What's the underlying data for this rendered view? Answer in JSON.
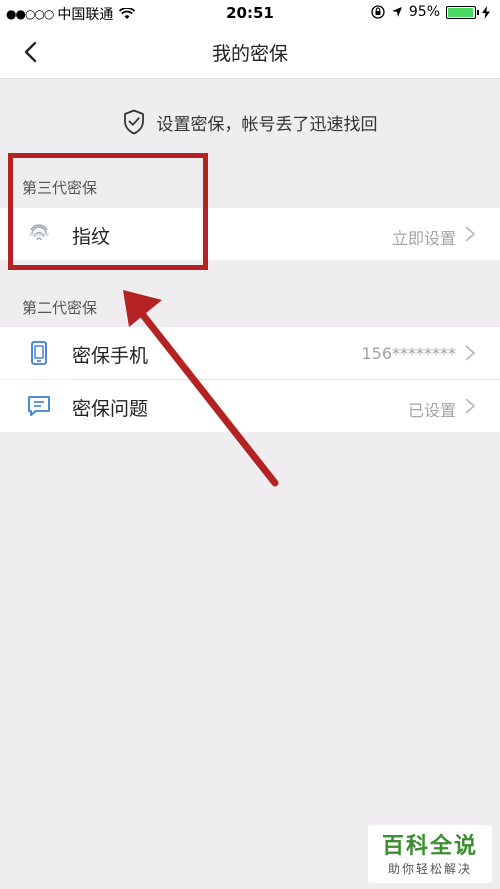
{
  "status_bar": {
    "signal": "●●○○○",
    "carrier": "中国联通",
    "time": "20:51",
    "battery_text": "95%",
    "battery_level": 0.95
  },
  "nav": {
    "title": "我的密保"
  },
  "notice": {
    "text": "设置密保，帐号丢了迅速找回"
  },
  "sections": {
    "third_gen": {
      "header": "第三代密保",
      "fingerprint": {
        "label": "指纹",
        "value": "立即设置"
      }
    },
    "second_gen": {
      "header": "第二代密保",
      "phone": {
        "label": "密保手机",
        "value": "156********"
      },
      "question": {
        "label": "密保问题",
        "value": "已设置"
      }
    }
  },
  "watermark": {
    "title": "百科全说",
    "subtitle": "助你轻松解决"
  },
  "colors": {
    "annotation": "#b52224",
    "icon_blue": "#3a7bd5",
    "watermark_green": "#3b8e2f",
    "background": "#efedef"
  }
}
